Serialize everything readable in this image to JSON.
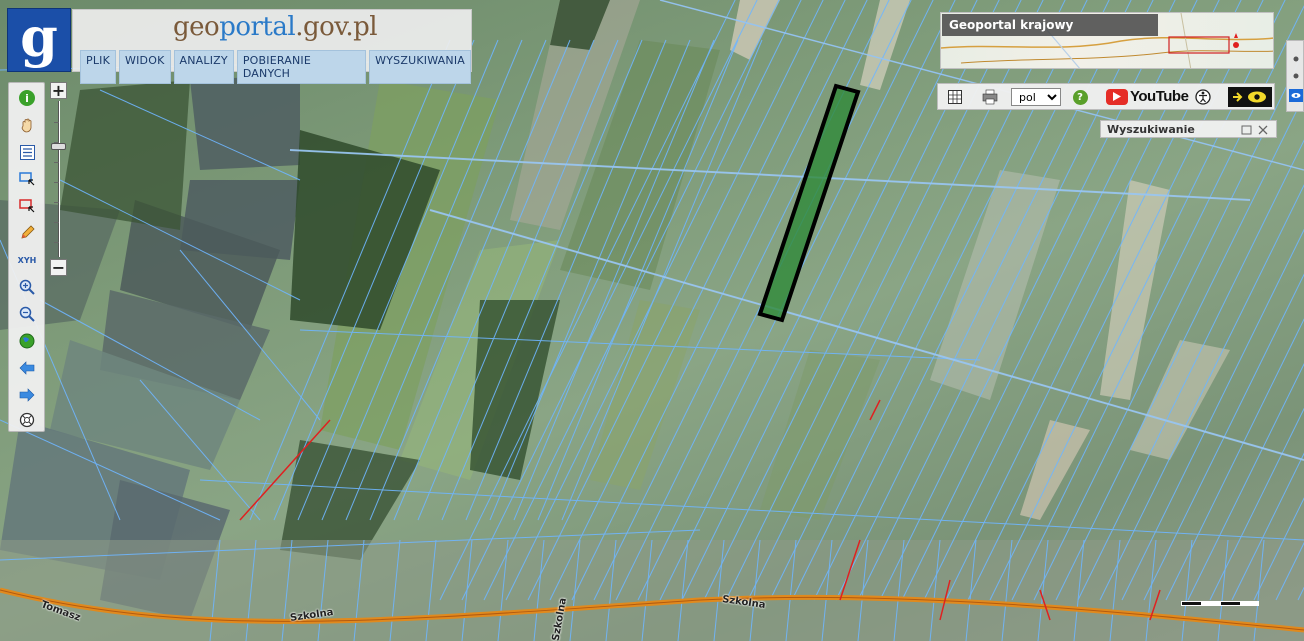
{
  "header": {
    "logo_letter": "g",
    "title_part1": "geo",
    "title_part2": "portal",
    "title_part3": ".gov.pl",
    "menu": [
      "PLIK",
      "WIDOK",
      "ANALIZY",
      "POBIERANIE DANYCH",
      "WYSZUKIWANIA"
    ]
  },
  "toolbar": {
    "zoom_in": "+",
    "zoom_out": "−",
    "coords_label": "XYH"
  },
  "overview": {
    "title": "Geoportal krajowy"
  },
  "right_toolbar": {
    "language": "pol",
    "language_options": [
      "pol"
    ],
    "youtube_label": "YouTube"
  },
  "search_panel": {
    "title": "Wyszukiwanie"
  },
  "map": {
    "streets": [
      "Szkolna",
      "Szkolna",
      "Tomasz",
      "Szkolna"
    ],
    "highlight_color": "#2f8a3a",
    "parcel_line_color": "#6fb6ff"
  },
  "colors": {
    "logo_bg": "#1b4fa8",
    "menu_bg": "#bdd6ea",
    "road": "#e08a1e"
  }
}
